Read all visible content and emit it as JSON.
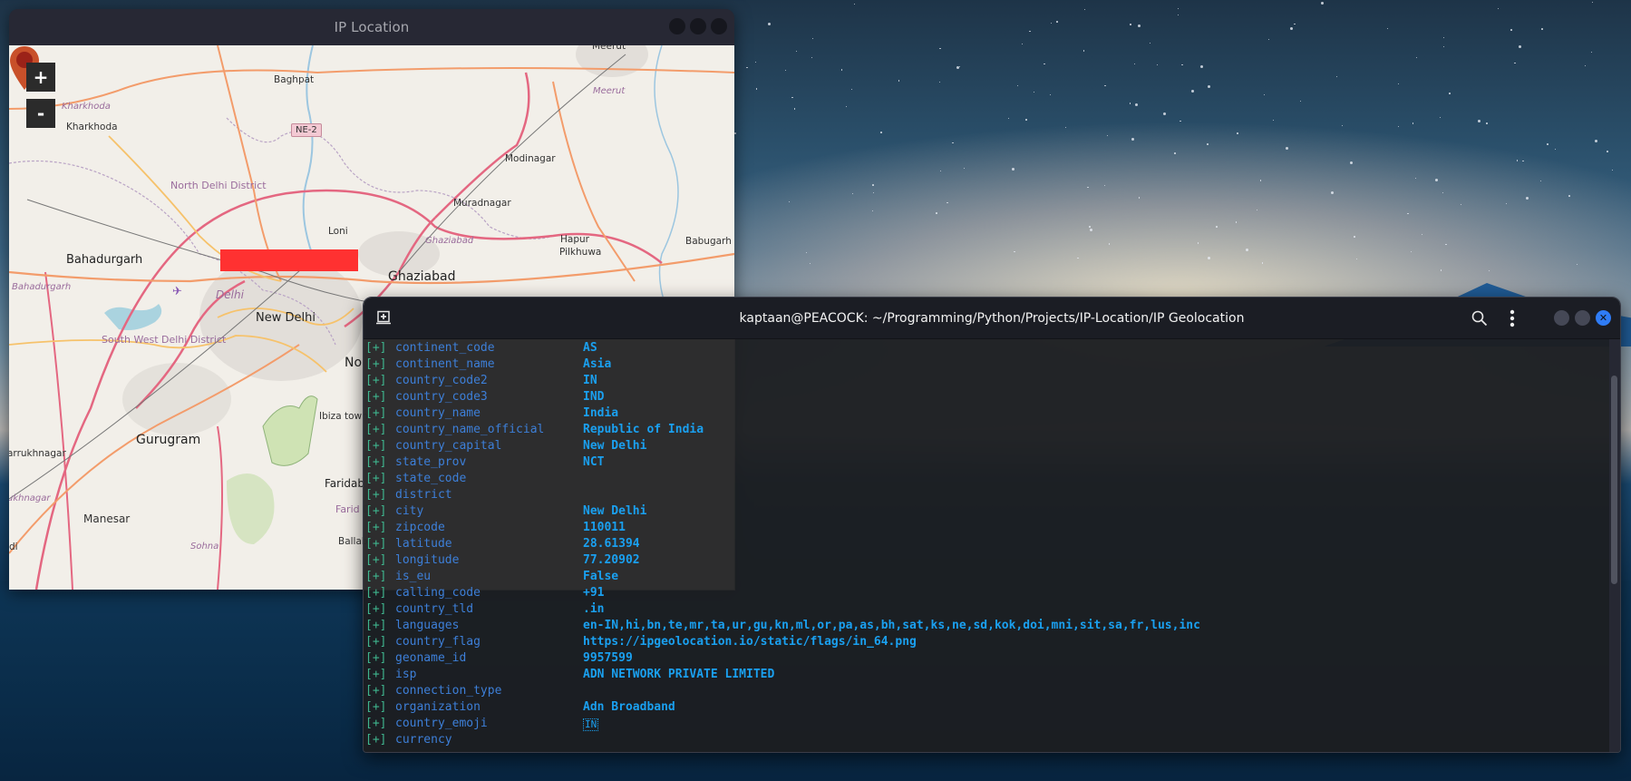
{
  "map_window": {
    "title": "IP Location",
    "zoom_in_label": "+",
    "zoom_out_label": "-",
    "redaction_color": "#ff3131",
    "marker_color": "#c8502a",
    "labels": {
      "baghpat": "Baghpat",
      "baghpat_italic": "Baghpat",
      "meerut": "Meerut",
      "meerut_italic": "Meerut",
      "kharkhoda_italic": "Kharkhoda",
      "kharkhoda": "Kharkhoda",
      "ne2": "NE-2",
      "modinagar": "Modinagar",
      "north_delhi": "North Delhi District",
      "muradnagar": "Muradnagar",
      "loni": "Loni",
      "ghaziabad_italic": "Ghaziabad",
      "pilkhuwa": "Pilkhuwa",
      "hapur": "Hapur",
      "babugarh": "Babugarh",
      "bahadurgarh": "Bahadurgarh",
      "bahadurgarh_italic": "Bahadurgarh",
      "ghaziabad": "Ghaziabad",
      "delhi_italic": "Delhi",
      "new_delhi": "New Delhi",
      "south_west_delhi": "South West Delhi District",
      "noida": "No",
      "ibiza_town": "Ibiza town",
      "gurugram": "Gurugram",
      "farrukhnagar": "arrukhnagar",
      "farrukhnagar_italic": "ukhnagar",
      "faridabad": "Faridab",
      "faridabad_district": "Farid Dis",
      "ballabgarh": "Ballab",
      "manesar": "Manesar",
      "sohna": "Sohna",
      "di": "di"
    }
  },
  "terminal": {
    "title": "kaptaan@PEACOCK: ~/Programming/Python/Projects/IP-Location/IP Geolocation",
    "close_glyph": "✕",
    "prefix": "[+]",
    "rows": [
      {
        "key": "continent_code",
        "value": "AS"
      },
      {
        "key": "continent_name",
        "value": "Asia"
      },
      {
        "key": "country_code2",
        "value": "IN"
      },
      {
        "key": "country_code3",
        "value": "IND"
      },
      {
        "key": "country_name",
        "value": "India"
      },
      {
        "key": "country_name_official",
        "value": "Republic of India"
      },
      {
        "key": "country_capital",
        "value": "New Delhi"
      },
      {
        "key": "state_prov",
        "value": "NCT"
      },
      {
        "key": "state_code",
        "value": ""
      },
      {
        "key": "district",
        "value": ""
      },
      {
        "key": "city",
        "value": "New Delhi"
      },
      {
        "key": "zipcode",
        "value": "110011"
      },
      {
        "key": "latitude",
        "value": "28.61394"
      },
      {
        "key": "longitude",
        "value": "77.20902"
      },
      {
        "key": "is_eu",
        "value": "False"
      },
      {
        "key": "calling_code",
        "value": "+91"
      },
      {
        "key": "country_tld",
        "value": ".in"
      },
      {
        "key": "languages",
        "value": "en-IN,hi,bn,te,mr,ta,ur,gu,kn,ml,or,pa,as,bh,sat,ks,ne,sd,kok,doi,mni,sit,sa,fr,lus,inc"
      },
      {
        "key": "country_flag",
        "value": "https://ipgeolocation.io/static/flags/in_64.png"
      },
      {
        "key": "geoname_id",
        "value": "9957599"
      },
      {
        "key": "isp",
        "value": "ADN NETWORK PRIVATE LIMITED"
      },
      {
        "key": "connection_type",
        "value": ""
      },
      {
        "key": "organization",
        "value": "Adn Broadband"
      },
      {
        "key": "country_emoji",
        "value": "IN",
        "emoji": true
      },
      {
        "key": "currency",
        "value": ""
      }
    ],
    "colors": {
      "prefix": "#3fb58e",
      "key": "#3d7fd8",
      "value": "#1aa0f0",
      "close_button": "#2f7cf6"
    }
  }
}
